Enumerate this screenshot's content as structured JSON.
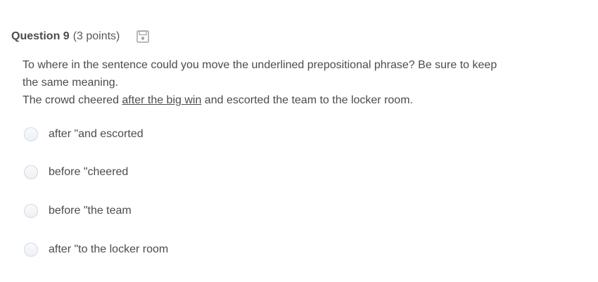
{
  "question": {
    "title": "Question 9",
    "points": "(3 points)",
    "save_icon": "save-icon",
    "prompt_line1": "To where in the sentence could you move the underlined prepositional phrase? Be sure to keep the same meaning.",
    "sentence_before": "The crowd cheered ",
    "sentence_underlined": "after the big win",
    "sentence_after": " and escorted the team to the locker room."
  },
  "choices": [
    {
      "label": "after \"and escorted"
    },
    {
      "label": "before \"cheered"
    },
    {
      "label": "before \"the team"
    },
    {
      "label": "after \"to the locker room"
    }
  ]
}
